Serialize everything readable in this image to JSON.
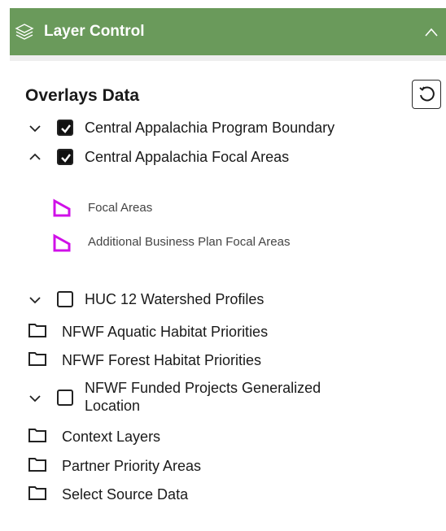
{
  "header": {
    "title": "Layer Control",
    "layers_icon": "layers-icon",
    "collapse_icon": "chevron-up-icon",
    "bg_color": "#6a9a5b"
  },
  "overlays": {
    "title": "Overlays Data",
    "reset_icon": "reset-icon"
  },
  "layers": [
    {
      "label": "Central Appalachia Program Boundary",
      "checked": true,
      "toggle": "chevron-down"
    },
    {
      "label": "Central Appalachia Focal Areas",
      "checked": true,
      "toggle": "chevron-up"
    },
    {
      "label": "HUC 12 Watershed Profiles",
      "checked": false,
      "toggle": "chevron-down"
    },
    {
      "label": "NFWF Aquatic Habitat Priorities",
      "type": "folder"
    },
    {
      "label": "NFWF Forest Habitat Priorities",
      "type": "folder"
    },
    {
      "label_line1": "NFWF Funded Projects Generalized",
      "label_line2": "Location",
      "checked": false,
      "toggle": "chevron-down"
    },
    {
      "label": "Context Layers",
      "type": "folder"
    },
    {
      "label": "Partner Priority Areas",
      "type": "folder"
    },
    {
      "label": "Select Source Data",
      "type": "folder"
    }
  ],
  "legend": {
    "items": [
      {
        "label": "Focal Areas",
        "color": "#d010e8"
      },
      {
        "label": "Additional Business Plan Focal Areas",
        "color": "#d010e8"
      }
    ]
  }
}
